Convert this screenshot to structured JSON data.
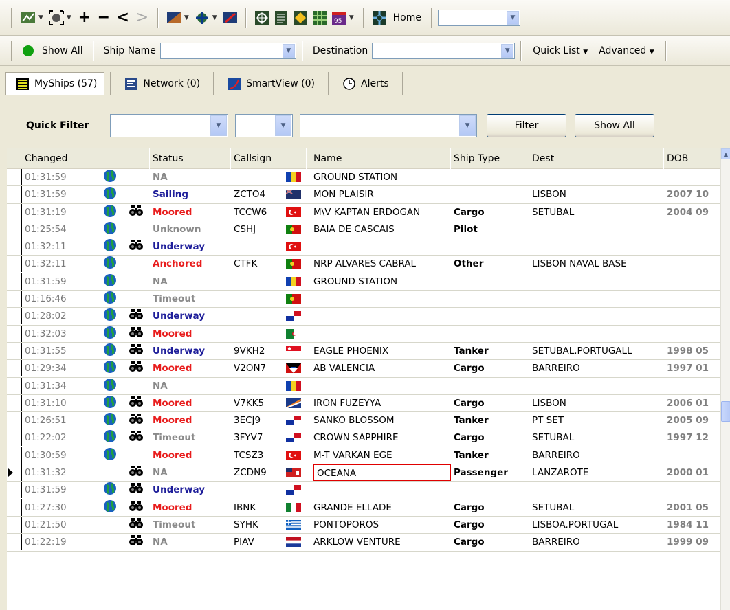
{
  "toolbar_main": {
    "home_label": "Home",
    "home_combo_value": ""
  },
  "toolbar_search": {
    "show_all_label": "Show All",
    "ship_name_label": "Ship Name",
    "ship_name_value": "",
    "destination_label": "Destination",
    "destination_value": "",
    "quick_list_label": "Quick List",
    "advanced_label": "Advanced"
  },
  "tabs": [
    {
      "label": "MyShips (57)"
    },
    {
      "label": "Network (0)"
    },
    {
      "label": "SmartView (0)"
    },
    {
      "label": "Alerts"
    }
  ],
  "quick_filter": {
    "label": "Quick Filter",
    "combo1_value": "",
    "combo2_value": "",
    "combo3_value": "",
    "filter_button": "Filter",
    "show_all_button": "Show All"
  },
  "grid": {
    "columns": [
      "Changed",
      "Status",
      "Callsign",
      "Name",
      "Ship Type",
      "Dest",
      "DOB"
    ],
    "rows": [
      {
        "changed": "01:31:59",
        "globe": true,
        "bino": false,
        "status": "NA",
        "callsign": "",
        "flag": "andorra",
        "name": "GROUND STATION",
        "type": "",
        "dest": "",
        "dob": ""
      },
      {
        "changed": "01:31:59",
        "globe": true,
        "bino": false,
        "status": "Sailing",
        "callsign": "ZCTO4",
        "flag": "blue-ensign",
        "name": "MON PLAISIR",
        "type": "",
        "dest": "LISBON",
        "dob": "2007 10"
      },
      {
        "changed": "01:31:19",
        "globe": true,
        "bino": true,
        "status": "Moored",
        "callsign": "TCCW6",
        "flag": "turkey",
        "name": "M\\V KAPTAN ERDOGAN",
        "type": "Cargo",
        "dest": "SETUBAL",
        "dob": "2004 09"
      },
      {
        "changed": "01:25:54",
        "globe": true,
        "bino": false,
        "status": "Unknown",
        "callsign": "CSHJ",
        "flag": "portugal",
        "name": "BAIA DE CASCAIS",
        "type": "Pilot",
        "dest": "",
        "dob": ""
      },
      {
        "changed": "01:32:11",
        "globe": true,
        "bino": true,
        "status": "Underway",
        "callsign": "",
        "flag": "turkey",
        "name": "",
        "type": "",
        "dest": "",
        "dob": ""
      },
      {
        "changed": "01:32:11",
        "globe": true,
        "bino": false,
        "status": "Anchored",
        "callsign": "CTFK",
        "flag": "portugal",
        "name": "NRP ALVARES CABRAL",
        "type": "Other",
        "dest": "LISBON NAVAL BASE",
        "dob": ""
      },
      {
        "changed": "01:31:59",
        "globe": true,
        "bino": false,
        "status": "NA",
        "callsign": "",
        "flag": "andorra",
        "name": "GROUND STATION",
        "type": "",
        "dest": "",
        "dob": ""
      },
      {
        "changed": "01:16:46",
        "globe": true,
        "bino": false,
        "status": "Timeout",
        "callsign": "",
        "flag": "portugal",
        "name": "",
        "type": "",
        "dest": "",
        "dob": ""
      },
      {
        "changed": "01:28:02",
        "globe": true,
        "bino": true,
        "status": "Underway",
        "callsign": "",
        "flag": "panama",
        "name": "",
        "type": "",
        "dest": "",
        "dob": ""
      },
      {
        "changed": "01:32:03",
        "globe": true,
        "bino": true,
        "status": "Moored",
        "callsign": "",
        "flag": "algeria",
        "name": "",
        "type": "",
        "dest": "",
        "dob": ""
      },
      {
        "changed": "01:31:55",
        "globe": true,
        "bino": true,
        "status": "Underway",
        "callsign": "9VKH2",
        "flag": "singapore",
        "name": "EAGLE PHOENIX",
        "type": "Tanker",
        "dest": "SETUBAL.PORTUGALL",
        "dob": "1998 05"
      },
      {
        "changed": "01:29:34",
        "globe": true,
        "bino": true,
        "status": "Moored",
        "callsign": "V2ON7",
        "flag": "antigua",
        "name": "AB VALENCIA",
        "type": "Cargo",
        "dest": "BARREIRO",
        "dob": "1997 01"
      },
      {
        "changed": "01:31:34",
        "globe": true,
        "bino": false,
        "status": "NA",
        "callsign": "",
        "flag": "andorra",
        "name": "",
        "type": "",
        "dest": "",
        "dob": ""
      },
      {
        "changed": "01:31:10",
        "globe": true,
        "bino": true,
        "status": "Moored",
        "callsign": "V7KK5",
        "flag": "marshall",
        "name": "IRON FUZEYYA",
        "type": "Cargo",
        "dest": "LISBON",
        "dob": "2006 01"
      },
      {
        "changed": "01:26:51",
        "globe": true,
        "bino": true,
        "status": "Moored",
        "callsign": "3ECJ9",
        "flag": "panama",
        "name": "SANKO BLOSSOM",
        "type": "Tanker",
        "dest": "PT SET",
        "dob": "2005 09"
      },
      {
        "changed": "01:22:02",
        "globe": true,
        "bino": true,
        "status": "Timeout",
        "callsign": "3FYV7",
        "flag": "panama",
        "name": "CROWN SAPPHIRE",
        "type": "Cargo",
        "dest": "SETUBAL",
        "dob": "1997 12"
      },
      {
        "changed": "01:30:59",
        "globe": true,
        "bino": false,
        "status": "Moored",
        "callsign": "TCSZ3",
        "flag": "turkey",
        "name": "M-T VARKAN EGE",
        "type": "Tanker",
        "dest": "BARREIRO",
        "dob": ""
      },
      {
        "changed": "01:31:32",
        "globe": false,
        "bino": true,
        "status": "NA",
        "callsign": "ZCDN9",
        "flag": "bermuda",
        "name": "OCEANA",
        "type": "Passenger",
        "dest": "LANZAROTE",
        "dob": "2000 01",
        "selected": true
      },
      {
        "changed": "01:31:59",
        "globe": true,
        "bino": true,
        "status": "Underway",
        "callsign": "",
        "flag": "panama",
        "name": "",
        "type": "",
        "dest": "",
        "dob": ""
      },
      {
        "changed": "01:27:30",
        "globe": true,
        "bino": true,
        "status": "Moored",
        "callsign": "IBNK",
        "flag": "italy",
        "name": "GRANDE ELLADE",
        "type": "Cargo",
        "dest": "SETUBAL",
        "dob": "2001 05"
      },
      {
        "changed": "01:21:50",
        "globe": false,
        "bino": true,
        "status": "Timeout",
        "callsign": "SYHK",
        "flag": "greece",
        "name": "PONTOPOROS",
        "type": "Cargo",
        "dest": "LISBOA.PORTUGAL",
        "dob": "1984 11"
      },
      {
        "changed": "01:22:19",
        "globe": false,
        "bino": true,
        "status": "NA",
        "callsign": "PIAV",
        "flag": "netherlands",
        "name": "ARKLOW VENTURE",
        "type": "Cargo",
        "dest": "BARREIRO",
        "dob": "1999 09"
      }
    ]
  }
}
